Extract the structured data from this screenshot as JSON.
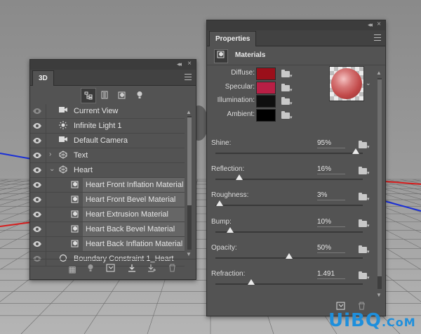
{
  "panel3d": {
    "tab": "3D",
    "collapse_glyph": "◂◂",
    "close_glyph": "×",
    "layers": [
      {
        "name": "Current View",
        "icon": "camera-icon",
        "child": false,
        "visible": false,
        "arrow": ""
      },
      {
        "name": "Infinite Light 1",
        "icon": "light-icon",
        "child": false,
        "visible": true,
        "arrow": ""
      },
      {
        "name": "Default Camera",
        "icon": "camera-icon",
        "child": false,
        "visible": true,
        "arrow": ""
      },
      {
        "name": "Text",
        "icon": "mesh-icon",
        "child": false,
        "visible": true,
        "arrow": "›"
      },
      {
        "name": "Heart",
        "icon": "mesh-icon",
        "child": false,
        "visible": true,
        "arrow": "⌄"
      },
      {
        "name": "Heart Front Inflation Material",
        "icon": "material-icon",
        "child": true,
        "visible": true,
        "arrow": ""
      },
      {
        "name": "Heart Front Bevel Material",
        "icon": "material-icon",
        "child": true,
        "visible": true,
        "arrow": ""
      },
      {
        "name": "Heart Extrusion Material",
        "icon": "material-icon",
        "child": true,
        "visible": true,
        "arrow": ""
      },
      {
        "name": "Heart Back Bevel Material",
        "icon": "material-icon",
        "child": true,
        "visible": true,
        "arrow": ""
      },
      {
        "name": "Heart Back Inflation Material",
        "icon": "material-icon",
        "child": true,
        "visible": true,
        "arrow": ""
      },
      {
        "name": "Boundary Constraint 1_Heart",
        "icon": "constraint-icon",
        "child": false,
        "visible": false,
        "arrow": ""
      }
    ]
  },
  "properties": {
    "tab": "Properties",
    "section_title": "Materials",
    "swatches": [
      {
        "label": "Diffuse:",
        "color": "#9b0f1a"
      },
      {
        "label": "Specular:",
        "color": "#b81f45"
      },
      {
        "label": "Illumination:",
        "color": "#0f0f0f"
      },
      {
        "label": "Ambient:",
        "color": "#000000"
      }
    ],
    "sliders": [
      {
        "label": "Shine:",
        "value": "95%",
        "fraction": 0.95
      },
      {
        "label": "Reflection:",
        "value": "16%",
        "fraction": 0.16
      },
      {
        "label": "Roughness:",
        "value": "3%",
        "fraction": 0.03
      },
      {
        "label": "Bump:",
        "value": "10%",
        "fraction": 0.1
      },
      {
        "label": "Opacity:",
        "value": "50%",
        "fraction": 0.5
      },
      {
        "label": "Refraction:",
        "value": "1.491",
        "fraction": 0.245
      }
    ]
  },
  "watermark": {
    "text": "UiBQ",
    "suffix": ".CoM"
  }
}
